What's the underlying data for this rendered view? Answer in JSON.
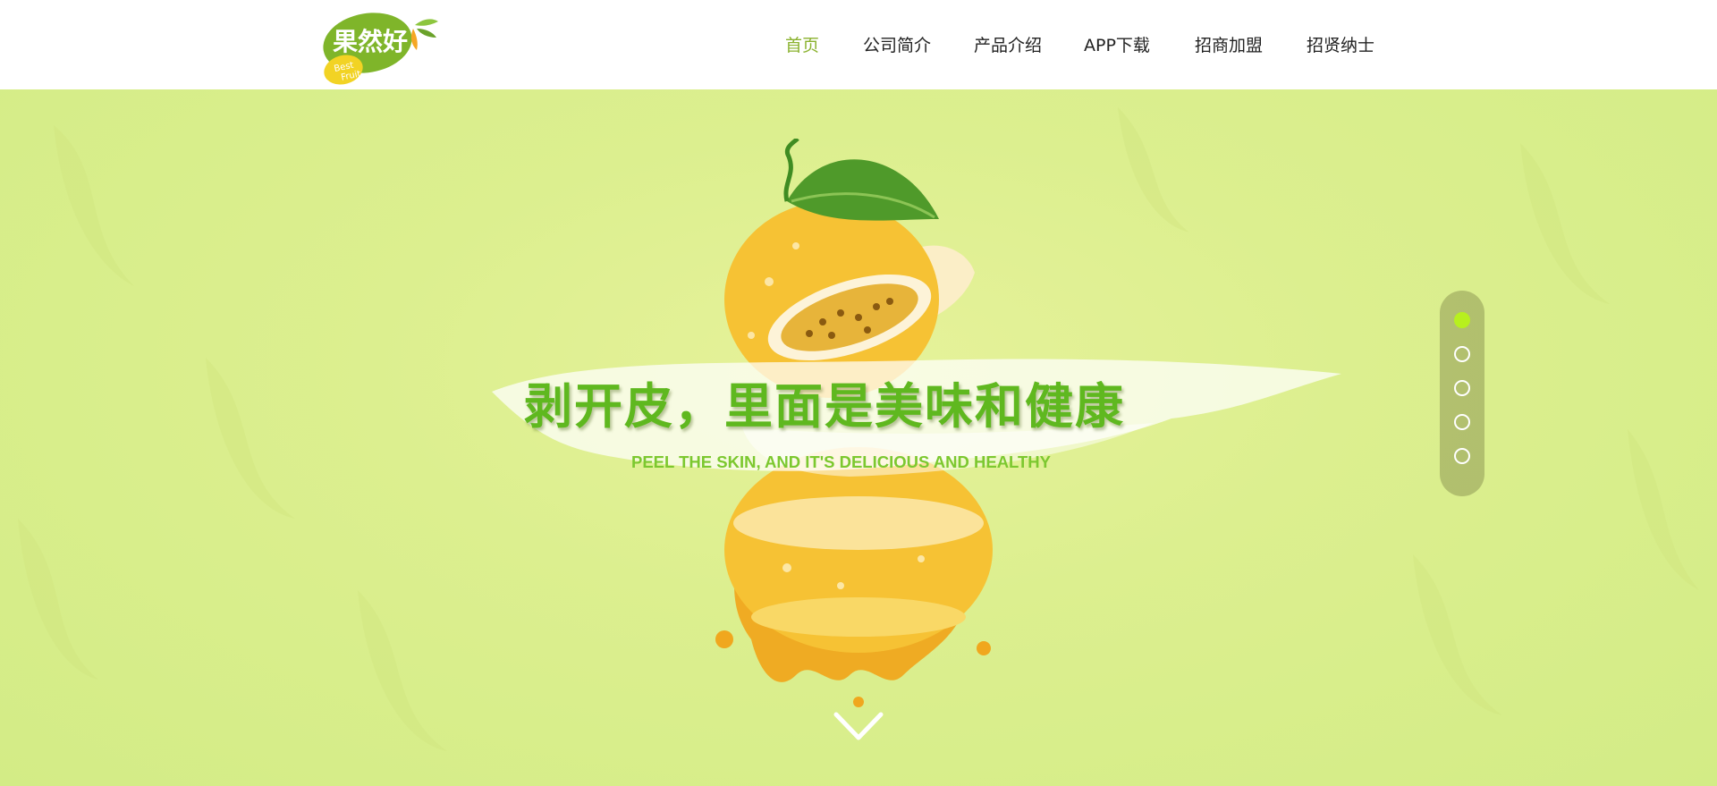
{
  "header": {
    "logo": {
      "text": "果然好",
      "tag": "Best Fruit"
    },
    "nav": [
      {
        "label": "首页",
        "active": true
      },
      {
        "label": "公司简介",
        "active": false
      },
      {
        "label": "产品介绍",
        "active": false
      },
      {
        "label": "APP下载",
        "active": false
      },
      {
        "label": "招商加盟",
        "active": false
      },
      {
        "label": "招贤纳士",
        "active": false
      }
    ]
  },
  "hero": {
    "headline": "剥开皮，里面是美味和健康",
    "subline": "PEEL THE SKIN, AND IT'S DELICIOUS AND HEALTHY",
    "slides_total": 5,
    "active_slide": 1,
    "scroll_icon": "chevron-down-icon"
  },
  "colors": {
    "accent": "#8ab22e",
    "headline": "#5fb81f",
    "hero_bg": "#dcef8f",
    "active_dot": "#b7f01e"
  }
}
